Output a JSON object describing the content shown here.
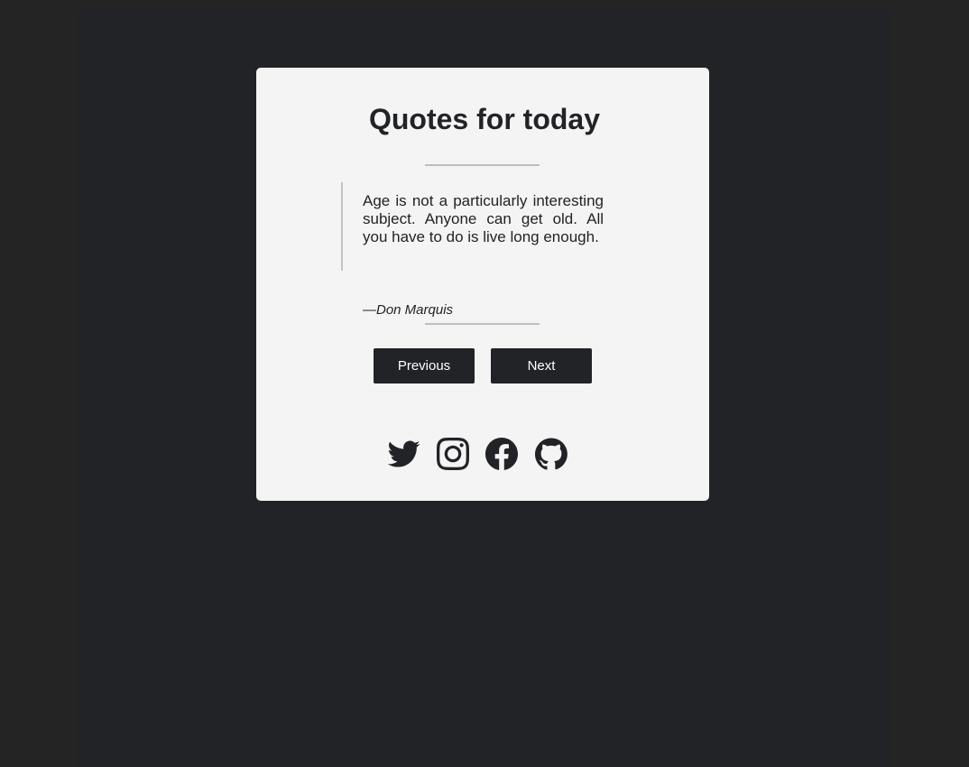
{
  "page": {
    "title": "Quotes for today"
  },
  "quote": {
    "text": "Age is not a particularly interesting subject. Anyone can get old. All you have to do is live long enough.",
    "author": "—Don Marquis"
  },
  "buttons": {
    "previous_label": "Previous",
    "next_label": "Next"
  },
  "social": [
    {
      "icon": "twitter-icon"
    },
    {
      "icon": "instagram-icon"
    },
    {
      "icon": "facebook-icon"
    },
    {
      "icon": "github-icon"
    }
  ],
  "colors": {
    "background": "#242424",
    "frame": "#222327",
    "card": "#f4f4f4",
    "text": "#222327",
    "button": "#222327"
  }
}
